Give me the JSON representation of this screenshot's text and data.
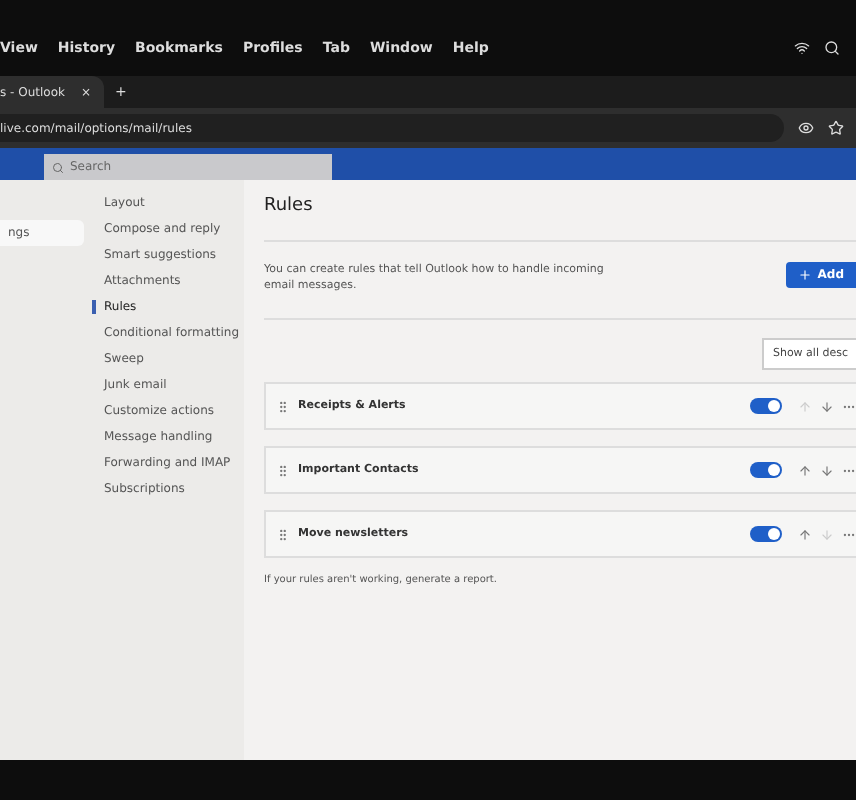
{
  "menu_bar": [
    "View",
    "History",
    "Bookmarks",
    "Profiles",
    "Tab",
    "Window",
    "Help"
  ],
  "tab": {
    "title": "s - Outlook",
    "close": "×"
  },
  "new_tab": "+",
  "address": "live.com/mail/options/mail/rules",
  "search": {
    "placeholder": "Search"
  },
  "settings_button": "ngs",
  "nav": [
    {
      "label": "Layout",
      "selected": false
    },
    {
      "label": "Compose and reply",
      "selected": false
    },
    {
      "label": "Smart suggestions",
      "selected": false
    },
    {
      "label": "Attachments",
      "selected": false
    },
    {
      "label": "Rules",
      "selected": true
    },
    {
      "label": "Conditional formatting",
      "selected": false
    },
    {
      "label": "Sweep",
      "selected": false
    },
    {
      "label": "Junk email",
      "selected": false
    },
    {
      "label": "Customize actions",
      "selected": false
    },
    {
      "label": "Message handling",
      "selected": false
    },
    {
      "label": "Forwarding and IMAP",
      "selected": false
    },
    {
      "label": "Subscriptions",
      "selected": false
    }
  ],
  "panel": {
    "title": "Rules",
    "description": "You can create rules that tell Outlook how to handle incoming email messages.",
    "add_button": "Add",
    "show_all_button": "Show all desc",
    "rules": [
      {
        "name": "Receipts & Alerts",
        "on": true,
        "up_disabled": true,
        "down_disabled": false
      },
      {
        "name": "Important Contacts",
        "on": true,
        "up_disabled": false,
        "down_disabled": false
      },
      {
        "name": "Move newsletters",
        "on": true,
        "up_disabled": false,
        "down_disabled": true
      }
    ],
    "footer": "If your rules aren't working, generate a report."
  }
}
